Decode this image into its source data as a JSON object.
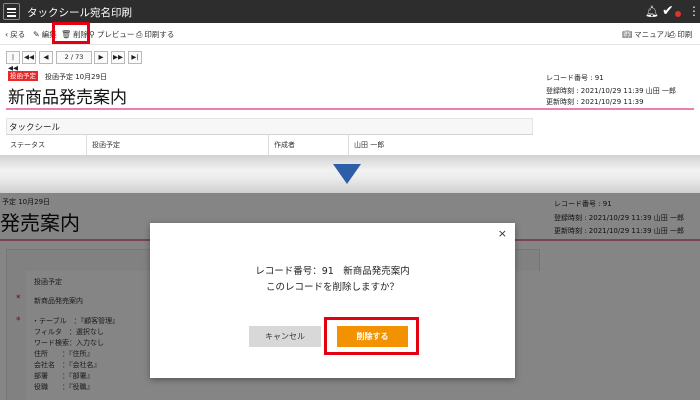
{
  "topbar": {
    "title": "タックシール宛名印刷",
    "more": "⋮"
  },
  "toolbar": {
    "back": "戻る",
    "edit": "編集",
    "delete": "削除",
    "preview": "プレビュー",
    "print": "印刷する",
    "manual": "マニュアル",
    "print_right": "印刷"
  },
  "pager": {
    "first": "|◀◀",
    "prev_fast": "◀◀",
    "prev": "◀",
    "page": "2 / 73",
    "next": "▶",
    "next_fast": "▶▶",
    "last": "▶|"
  },
  "record": {
    "badge": "投函予定",
    "date_label": "投函予定 10月29日",
    "title": "新商品発売案内",
    "record_no": "レコード番号 : 91",
    "created": "登録時刻 : 2021/10/29 11:39 山田 一郎",
    "updated": "更新時刻 : 2021/10/29 11:39"
  },
  "section": {
    "title": "タックシール",
    "status_label": "ステータス",
    "status_value": "投函予定",
    "author_label": "作成者",
    "author_value": "山田 一郎"
  },
  "bottom": {
    "date_frag": "予定 10月29日",
    "title_frag": "発売案内",
    "record_no": "レコード番号 : 91",
    "created": "登録時刻 : 2021/10/29 11:39 山田 一郎",
    "updated": "更新時刻 : 2021/10/29 11:39 山田 一郎",
    "status": "投函予定",
    "name": "新商品発売案内",
    "asterisk": "*",
    "config": [
      "・テーブル　：『顧客管理』",
      "フィルタ　：選択なし",
      "ワード検索：入力なし",
      "住所　　：『住所』",
      "会社名　：『会社名』",
      "部署　　：『部署』",
      "役職　　：『役職』"
    ]
  },
  "dialog": {
    "close": "×",
    "line1": "レコード番号：91　新商品発売案内",
    "line2": "このレコードを削除しますか？",
    "cancel": "キャンセル",
    "confirm": "削除する"
  }
}
